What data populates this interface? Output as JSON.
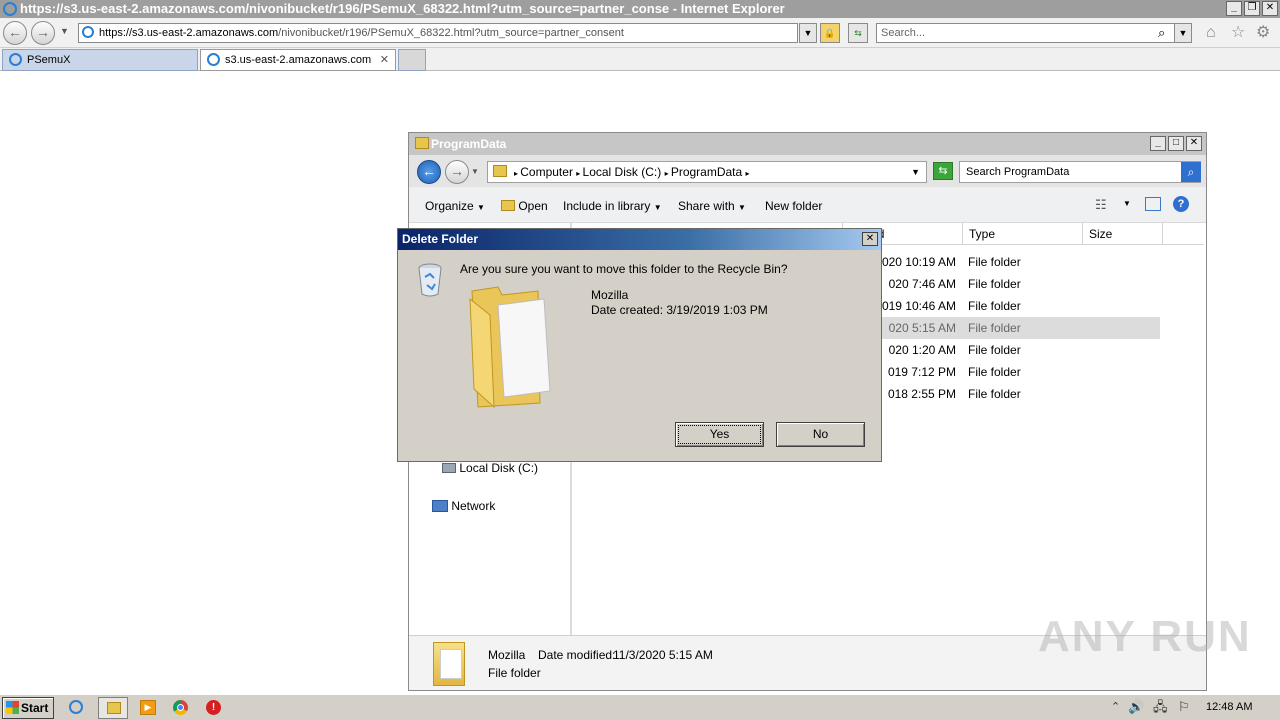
{
  "browser": {
    "window_title": "https://s3.us-east-2.amazonaws.com/nivonibucket/r196/PSemuX_68322.html?utm_source=partner_conse - Internet Explorer",
    "address_prefix": "https://s3.us-east-2.",
    "address_host": "amazonaws.com",
    "address_rest": "/nivonibucket/r196/PSemuX_68322.html?utm_source=partner_consent",
    "search_placeholder": "Search...",
    "tabs": [
      {
        "label": "PSemuX",
        "active": false
      },
      {
        "label": "s3.us-east-2.amazonaws.com",
        "active": true
      }
    ]
  },
  "explorer": {
    "title": "ProgramData",
    "breadcrumb": [
      "Computer",
      "Local Disk (C:)",
      "ProgramData"
    ],
    "search_placeholder": "Search ProgramData",
    "toolbar": {
      "organize": "Organize",
      "open": "Open",
      "include_in_library": "Include in library",
      "share_with": "Share with",
      "new_folder": "New folder"
    },
    "columns": {
      "date_modified": "odified",
      "type": "Type",
      "size": "Size"
    },
    "rows": [
      {
        "modified": "020 10:19 AM",
        "type": "File folder"
      },
      {
        "modified": "020 7:46 AM",
        "type": "File folder"
      },
      {
        "modified": "019 10:46 AM",
        "type": "File folder"
      },
      {
        "modified": "020 5:15 AM",
        "type": "File folder"
      },
      {
        "modified": "020 1:20 AM",
        "type": "File folder"
      },
      {
        "modified": "019 7:12 PM",
        "type": "File folder"
      },
      {
        "modified": "018 2:55 PM",
        "type": "File folder"
      }
    ],
    "nav_pane": {
      "local_disk": "Local Disk (C:)",
      "network": "Network"
    },
    "details": {
      "name": "Mozilla",
      "date_modified_label": "Date modified:",
      "date_modified_value": "11/3/2020 5:15 AM",
      "type": "File folder"
    }
  },
  "dialog": {
    "title": "Delete Folder",
    "question": "Are you sure you want to move this folder to the Recycle Bin?",
    "item_name": "Mozilla",
    "date_created": "Date created: 3/19/2019 1:03 PM",
    "yes_label": "Yes",
    "no_label": "No"
  },
  "taskbar": {
    "start_label": "Start",
    "clock": "12:48 AM"
  },
  "watermark": "ANY RUN"
}
